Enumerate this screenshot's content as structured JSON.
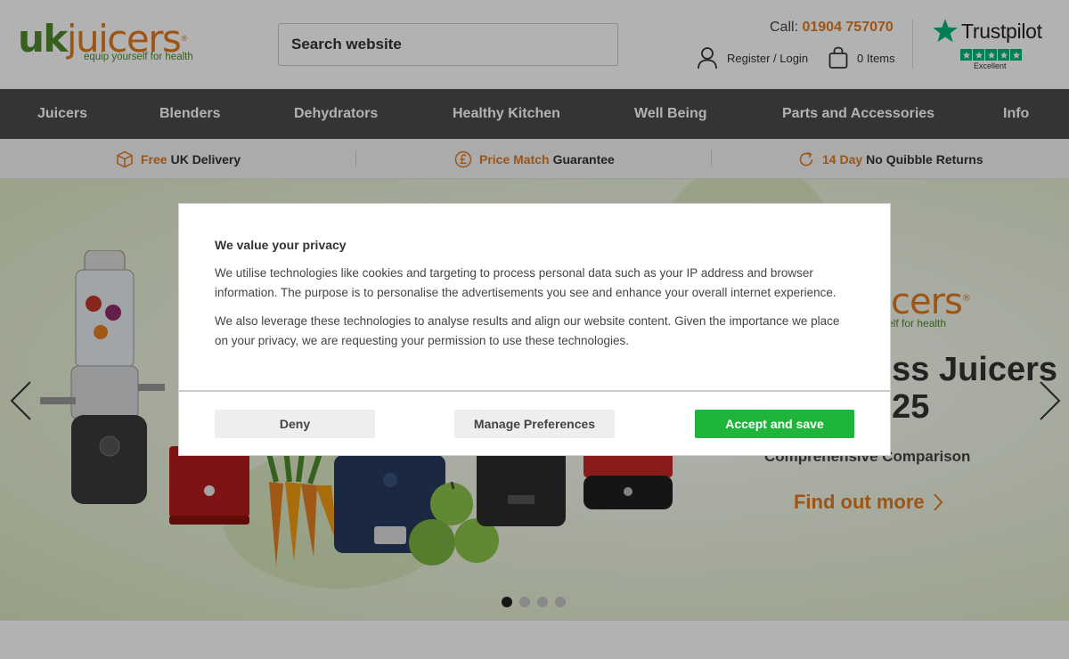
{
  "header": {
    "logo": {
      "uk": "uk",
      "juicers": "juicers",
      "reg": "®",
      "tagline": "equip yourself for health"
    },
    "search": {
      "placeholder": "Search website"
    },
    "call": {
      "label": "Call:",
      "number": "01904 757070"
    },
    "account": {
      "label": "Register / Login",
      "icon": "user-icon"
    },
    "basket": {
      "label": "0 Items",
      "icon": "basket-icon"
    },
    "trustpilot": {
      "name": "Trustpilot",
      "rating_label": "Excellent",
      "stars": 5
    }
  },
  "nav": {
    "items": [
      {
        "label": "Juicers"
      },
      {
        "label": "Blenders"
      },
      {
        "label": "Dehydrators"
      },
      {
        "label": "Healthy Kitchen"
      },
      {
        "label": "Well Being"
      },
      {
        "label": "Parts and Accessories"
      },
      {
        "label": "Info"
      }
    ]
  },
  "usp": {
    "items": [
      {
        "accent": "Free",
        "rest": "UK Delivery",
        "icon": "box-icon"
      },
      {
        "accent": "Price Match",
        "rest": "Guarantee",
        "icon": "pound-icon"
      },
      {
        "accent": "14 Day",
        "rest": "No Quibble Returns",
        "icon": "refresh-icon"
      }
    ]
  },
  "hero": {
    "logo_text": "cers",
    "logo_reg": "®",
    "logo_tagline": "self for health",
    "title_line1": "ess Juicers",
    "title_line2": "025",
    "subtitle": "Comprehensive Comparison",
    "cta": "Find out more",
    "slide_count": 4,
    "active_slide": 1
  },
  "cookie": {
    "title": "We value your privacy",
    "paragraph1": "We utilise technologies like cookies and targeting to process personal data such as your IP address and browser information. The purpose is to personalise the advertisements you see and enhance your overall internet experience.",
    "paragraph2": "We also leverage these technologies to analyse results and align our website content. Given the importance we place on your privacy, we are requesting your permission to use these technologies.",
    "deny": "Deny",
    "manage": "Manage Preferences",
    "accept": "Accept and save"
  },
  "colors": {
    "brand_green": "#4f8a2b",
    "brand_orange": "#e07a1f",
    "nav_bg": "#4b4b4b",
    "accept_green": "#1fb53b",
    "trustpilot_green": "#00b67a"
  }
}
